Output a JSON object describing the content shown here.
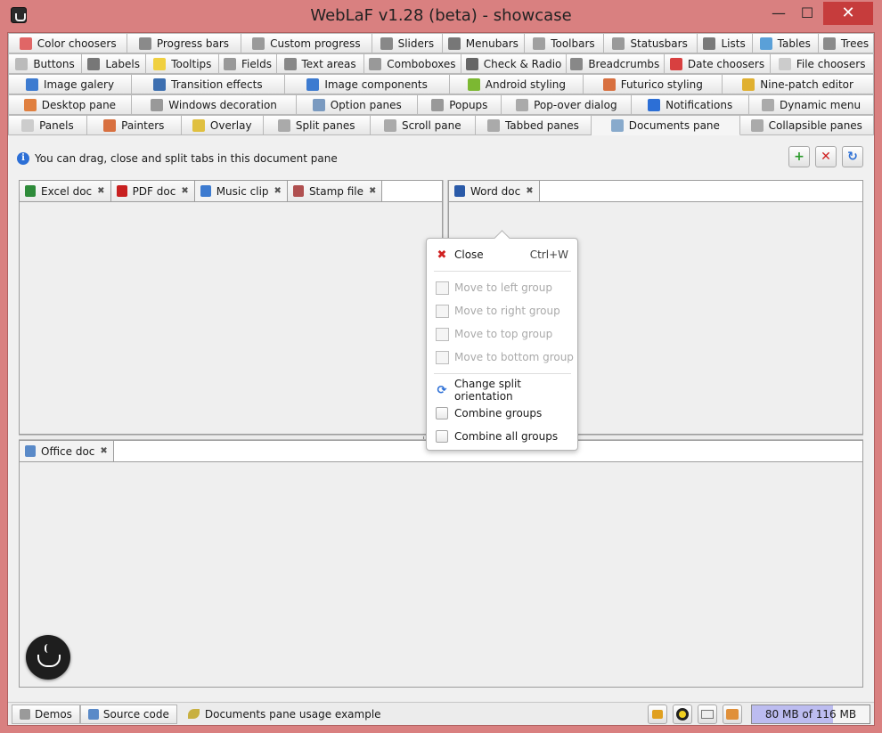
{
  "window": {
    "title": "WebLaF v1.28 (beta) - showcase",
    "minimize": "—",
    "maximize": "☐",
    "close": "✕"
  },
  "tab_rows": [
    [
      {
        "label": "Color choosers",
        "icon": "color-palette-icon",
        "color": "#e06666",
        "w": 130
      },
      {
        "label": "Progress bars",
        "icon": "progress-bar-icon",
        "color": "#8a8a8a",
        "w": 124
      },
      {
        "label": "Custom progress",
        "icon": "custom-progress-icon",
        "color": "#9a9a9a",
        "w": 144
      },
      {
        "label": "Sliders",
        "icon": "slider-icon",
        "color": "#888888",
        "w": 76
      },
      {
        "label": "Menubars",
        "icon": "menubar-icon",
        "color": "#777777",
        "w": 90
      },
      {
        "label": "Toolbars",
        "icon": "toolbar-icon",
        "color": "#a0a0a0",
        "w": 86
      },
      {
        "label": "Statusbars",
        "icon": "statusbar-icon",
        "color": "#9a9a9a",
        "w": 102
      },
      {
        "label": "Lists",
        "icon": "list-icon",
        "color": "#7a7a7a",
        "w": 60
      },
      {
        "label": "Tables",
        "icon": "table-icon",
        "color": "#5aa0d8",
        "w": 72
      },
      {
        "label": "Trees",
        "icon": "tree-icon",
        "color": "#8a8a8a",
        "w": 60
      }
    ],
    [
      {
        "label": "Buttons",
        "icon": "button-icon",
        "color": "#bbbbbb",
        "w": 82
      },
      {
        "label": "Labels",
        "icon": "label-icon",
        "color": "#777777",
        "w": 72
      },
      {
        "label": "Tooltips",
        "icon": "tooltip-icon",
        "color": "#f0d040",
        "w": 82
      },
      {
        "label": "Fields",
        "icon": "field-icon",
        "color": "#999999",
        "w": 64
      },
      {
        "label": "Text areas",
        "icon": "text-area-icon",
        "color": "#888888",
        "w": 98
      },
      {
        "label": "Comboboxes",
        "icon": "combobox-icon",
        "color": "#999999",
        "w": 110
      },
      {
        "label": "Check & Radio",
        "icon": "checkbox-icon",
        "color": "#666666",
        "w": 118
      },
      {
        "label": "Breadcrumbs",
        "icon": "breadcrumb-icon",
        "color": "#888888",
        "w": 110
      },
      {
        "label": "Date choosers",
        "icon": "calendar-icon",
        "color": "#d84040",
        "w": 120
      },
      {
        "label": "File choosers",
        "icon": "file-icon",
        "color": "#cccccc",
        "w": 116
      }
    ],
    [
      {
        "label": "Image galery",
        "icon": "image-gallery-icon",
        "color": "#3d7bd0",
        "w": 138
      },
      {
        "label": "Transition effects",
        "icon": "transition-icon",
        "color": "#3d6fb0",
        "w": 172
      },
      {
        "label": "Image components",
        "icon": "image-icon",
        "color": "#3d7bd0",
        "w": 186
      },
      {
        "label": "Android styling",
        "icon": "android-icon",
        "color": "#7cb832",
        "w": 150
      },
      {
        "label": "Futurico styling",
        "icon": "paint-icon",
        "color": "#d87040",
        "w": 156
      },
      {
        "label": "Nine-patch editor",
        "icon": "nine-patch-icon",
        "color": "#e0b030",
        "w": 170
      }
    ],
    [
      {
        "label": "Desktop pane",
        "icon": "desktop-icon",
        "color": "#e08040",
        "w": 138
      },
      {
        "label": "Windows decoration",
        "icon": "window-icon",
        "color": "#999999",
        "w": 186
      },
      {
        "label": "Option panes",
        "icon": "option-pane-icon",
        "color": "#7a9ac0",
        "w": 136
      },
      {
        "label": "Popups",
        "icon": "popup-icon",
        "color": "#999999",
        "w": 94
      },
      {
        "label": "Pop-over dialog",
        "icon": "popover-icon",
        "color": "#aaaaaa",
        "w": 146
      },
      {
        "label": "Notifications",
        "icon": "info-icon",
        "color": "#2c6fd6",
        "w": 132
      },
      {
        "label": "Dynamic menu",
        "icon": "dynamic-menu-icon",
        "color": "#aaaaaa",
        "w": 140
      }
    ],
    [
      {
        "label": "Panels",
        "icon": "panel-icon",
        "color": "#cccccc",
        "w": 86
      },
      {
        "label": "Painters",
        "icon": "painter-icon",
        "color": "#d87040",
        "w": 104
      },
      {
        "label": "Overlay",
        "icon": "overlay-icon",
        "color": "#e0c040",
        "w": 90
      },
      {
        "label": "Split panes",
        "icon": "split-pane-icon",
        "color": "#aaaaaa",
        "w": 118
      },
      {
        "label": "Scroll pane",
        "icon": "scroll-pane-icon",
        "color": "#aaaaaa",
        "w": 116
      },
      {
        "label": "Tabbed panes",
        "icon": "tabbed-pane-icon",
        "color": "#aaaaaa",
        "w": 128
      },
      {
        "label": "Documents pane",
        "icon": "documents-icon",
        "color": "#88aacc",
        "w": 164,
        "active": true
      },
      {
        "label": "Collapsible panes",
        "icon": "collapsible-pane-icon",
        "color": "#aaaaaa",
        "w": 148
      }
    ]
  ],
  "info": {
    "text": "You can drag, close and split tabs in this document pane",
    "icon": "info-icon"
  },
  "toolbar": {
    "add": "add-document-icon",
    "remove": "remove-document-icon",
    "refresh": "refresh-icon"
  },
  "left_pane": {
    "tabs": [
      {
        "label": "Excel doc",
        "icon": "excel-icon",
        "color": "#2e8b3a"
      },
      {
        "label": "PDF doc",
        "icon": "pdf-icon",
        "color": "#c82020"
      },
      {
        "label": "Music clip",
        "icon": "music-icon",
        "color": "#3d7bd0",
        "active": true
      },
      {
        "label": "Stamp file",
        "icon": "stamp-icon",
        "color": "#b05050"
      }
    ]
  },
  "right_pane": {
    "tabs": [
      {
        "label": "Word doc",
        "icon": "word-icon",
        "color": "#2a5aa8",
        "active": true
      }
    ]
  },
  "bottom_pane": {
    "tabs": [
      {
        "label": "Office doc",
        "icon": "office-icon",
        "color": "#5a8ac8",
        "active": true
      }
    ]
  },
  "context_menu": {
    "close": {
      "label": "Close",
      "accelerator": "Ctrl+W"
    },
    "move_left": "Move to left group",
    "move_right": "Move to right group",
    "move_top": "Move to top group",
    "move_bottom": "Move to bottom group",
    "change_orientation": "Change split orientation",
    "combine_groups": "Combine groups",
    "combine_all": "Combine all groups"
  },
  "status": {
    "breadcrumb": [
      {
        "label": "Demos",
        "icon": "demos-icon"
      },
      {
        "label": "Source code",
        "icon": "source-code-icon"
      }
    ],
    "label": "Documents pane usage example",
    "memory_text": "80 MB of 116 MB",
    "memory_used_fraction": 0.69
  },
  "colors": {
    "frame": "#d98080",
    "close_button": "#c63c3c",
    "memory_fill": "#bcbcf0"
  }
}
